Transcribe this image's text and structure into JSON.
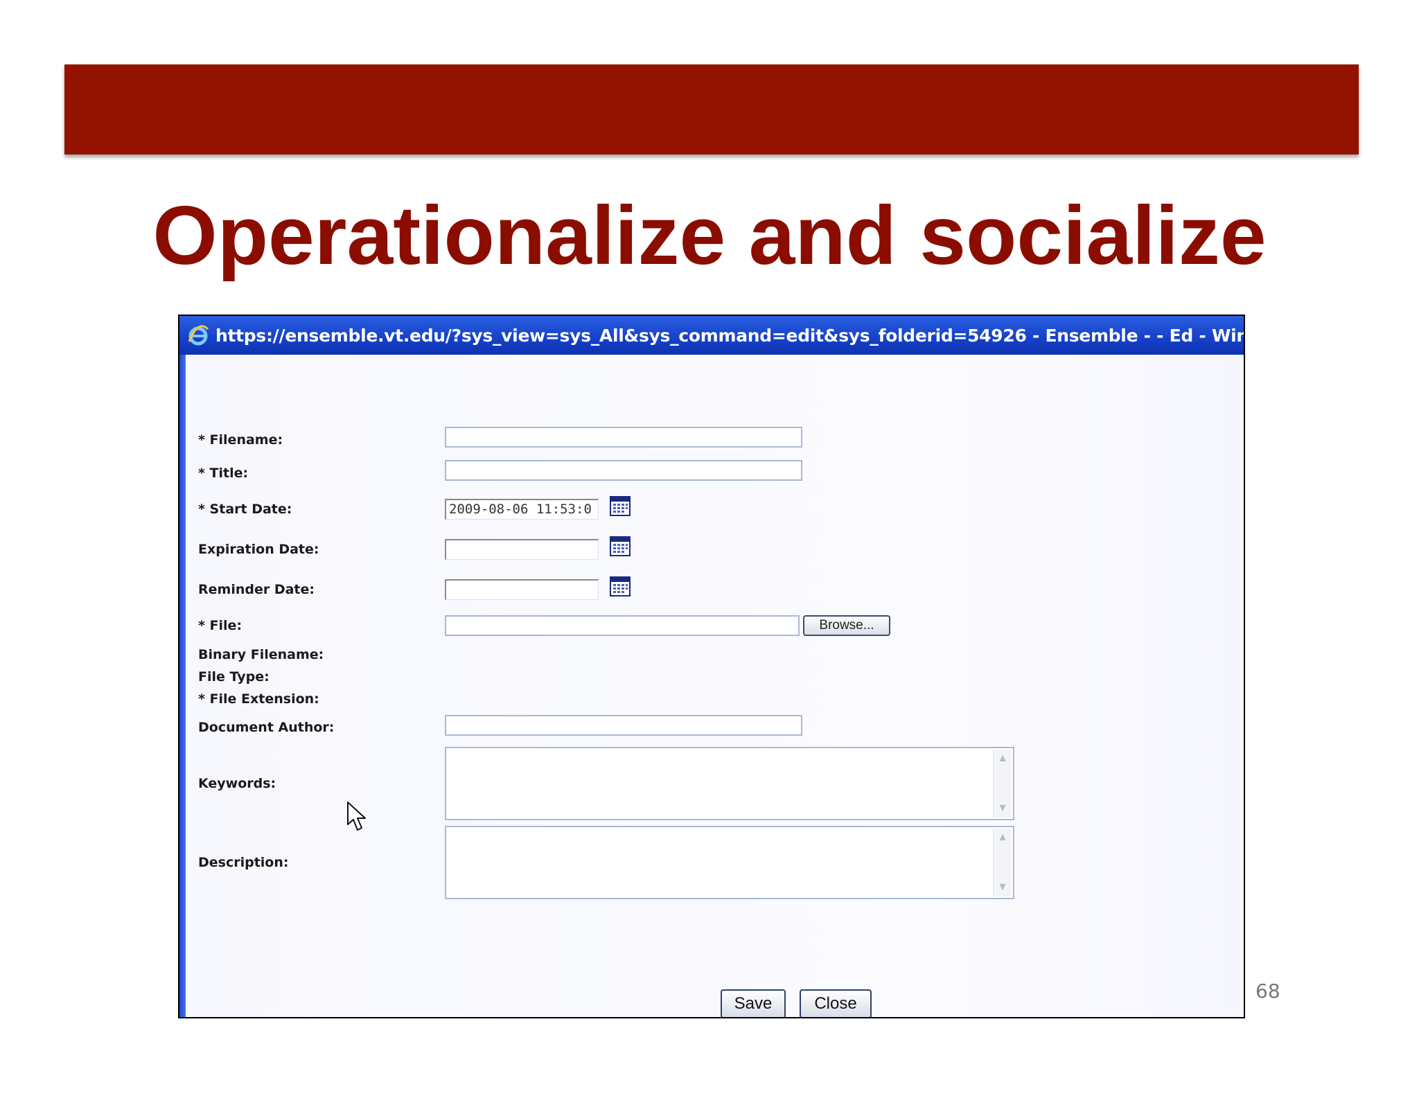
{
  "slide": {
    "title": "Operationalize and socialize",
    "page_number": "68"
  },
  "window": {
    "title": "https://ensemble.vt.edu/?sys_view=sys_All&sys_command=edit&sys_folderid=54926 - Ensemble - - Ed - Windows Internet E"
  },
  "form": {
    "filename_label": "* Filename:",
    "filename_value": "",
    "title_label": "* Title:",
    "title_value": "",
    "start_date_label": "* Start Date:",
    "start_date_value": "2009-08-06 11:53:0",
    "expiration_date_label": "Expiration Date:",
    "expiration_date_value": "",
    "reminder_date_label": "Reminder Date:",
    "reminder_date_value": "",
    "file_label": "* File:",
    "file_value": "",
    "browse_label": "Browse...",
    "binary_filename_label": "Binary Filename:",
    "file_type_label": "File Type:",
    "file_extension_label": "* File Extension:",
    "document_author_label": "Document Author:",
    "document_author_value": "",
    "keywords_label": "Keywords:",
    "description_label": "Description:",
    "save_label": "Save",
    "close_label": "Close"
  },
  "icons": {
    "browser": "ie-icon",
    "calendar": "calendar-icon",
    "cursor": "mouse-pointer-icon"
  },
  "colors": {
    "banner": "#931200",
    "title": "#8b0d00",
    "titlebar": "#1540c8"
  }
}
